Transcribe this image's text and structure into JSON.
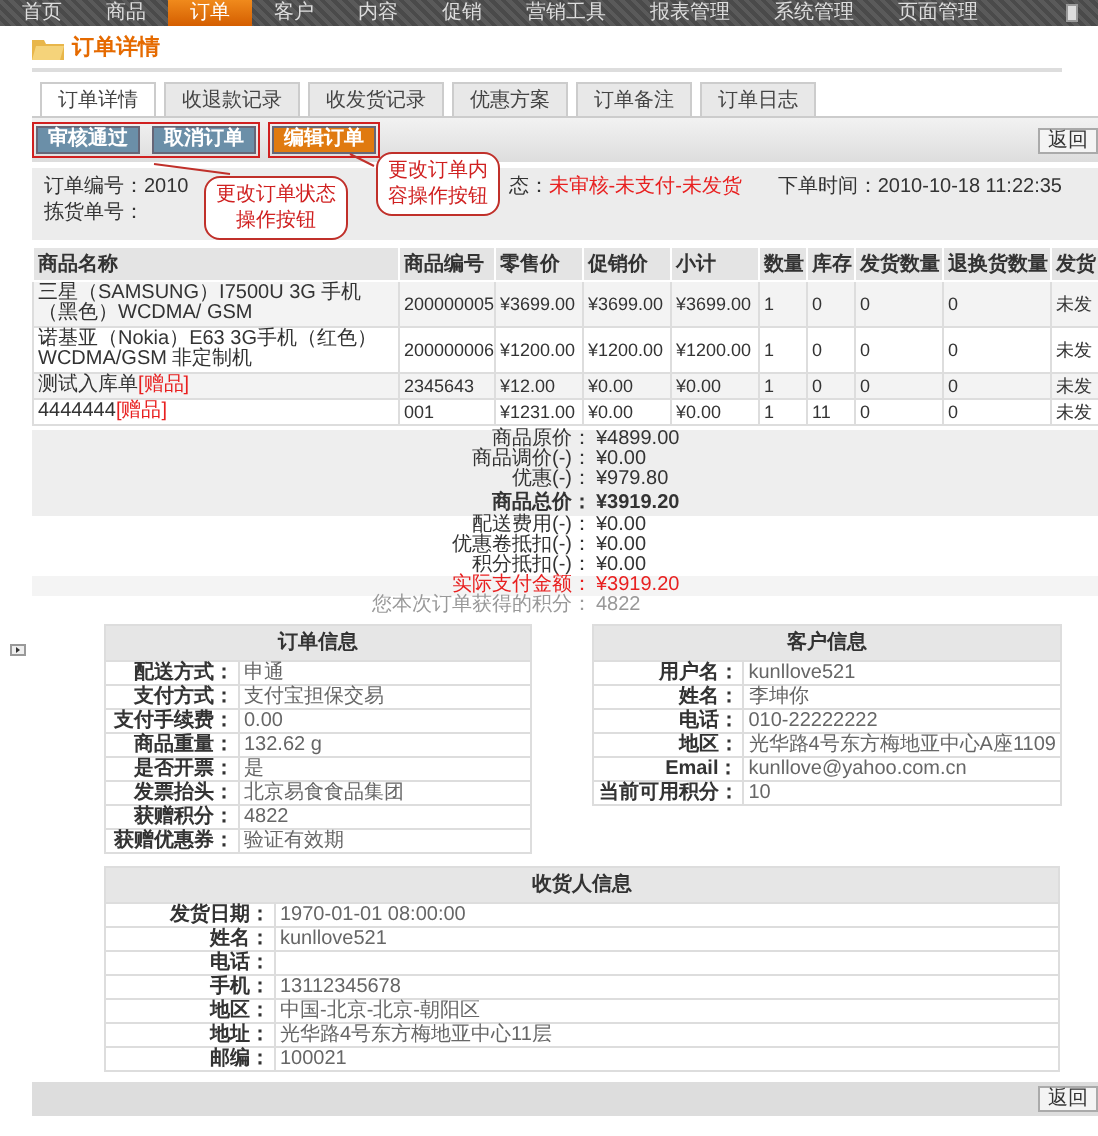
{
  "nav": [
    {
      "label": "首页",
      "selected": false
    },
    {
      "label": "商品",
      "selected": false
    },
    {
      "label": "订单",
      "selected": true
    },
    {
      "label": "客户",
      "selected": false
    },
    {
      "label": "内容",
      "selected": false
    },
    {
      "label": "促销",
      "selected": false
    },
    {
      "label": "营销工具",
      "selected": false
    },
    {
      "label": "报表管理",
      "selected": false
    },
    {
      "label": "系统管理",
      "selected": false
    },
    {
      "label": "页面管理",
      "selected": false
    }
  ],
  "page_title": "订单详情",
  "tabs": [
    {
      "label": "订单详情",
      "selected": true
    },
    {
      "label": "收退款记录",
      "selected": false
    },
    {
      "label": "收发货记录",
      "selected": false
    },
    {
      "label": "优惠方案",
      "selected": false
    },
    {
      "label": "订单备注",
      "selected": false
    },
    {
      "label": "订单日志",
      "selected": false
    }
  ],
  "actions": [
    {
      "label": "审核通过",
      "kind": "status"
    },
    {
      "label": "取消订单",
      "kind": "status"
    },
    {
      "label": "编辑订单",
      "kind": "edit"
    }
  ],
  "top_back_label": "返回",
  "callouts": [
    {
      "lines": [
        "更改订单状态",
        "操作按钮"
      ]
    },
    {
      "lines": [
        "更改订单内",
        "容操作按钮"
      ]
    }
  ],
  "order_header": {
    "number_label": "订单编号：",
    "number_value": "2010",
    "status_label": "态：",
    "status_value": "未审核-未支付-未发货",
    "time_label": "下单时间：",
    "time_value": "2010-10-18 11:22:35",
    "pick_label": "拣货单号："
  },
  "products": {
    "columns": [
      "商品名称",
      "商品编号",
      "零售价",
      "促销价",
      "小计",
      "数量",
      "库存",
      "发货数量",
      "退换货数量",
      "发货"
    ],
    "rows": [
      {
        "tag": null,
        "cells": [
          "三星（SAMSUNG）I7500U 3G 手机（黑色）WCDMA/ GSM",
          "200000005",
          "¥3699.00",
          "¥3699.00",
          "¥3699.00",
          "1",
          "0",
          "0",
          "0",
          "未发"
        ]
      },
      {
        "tag": null,
        "cells": [
          "诺基亚（Nokia）E63 3G手机（红色） WCDMA/GSM 非定制机",
          "200000006",
          "¥1200.00",
          "¥1200.00",
          "¥1200.00",
          "1",
          "0",
          "0",
          "0",
          "未发"
        ]
      },
      {
        "tag": "[赠品]",
        "cells": [
          "测试入库单",
          "2345643",
          "¥12.00",
          "¥0.00",
          "¥0.00",
          "1",
          "0",
          "0",
          "0",
          "未发"
        ]
      },
      {
        "tag": "[赠品]",
        "cells": [
          "4444444",
          "001",
          "¥1231.00",
          "¥0.00",
          "¥0.00",
          "1",
          "11",
          "0",
          "0",
          "未发"
        ]
      }
    ]
  },
  "summary": [
    {
      "label": "商品原价：",
      "value": "¥4899.00",
      "kind": "normal"
    },
    {
      "label": "商品调价(-)：",
      "value": "¥0.00",
      "kind": "normal"
    },
    {
      "label": "优惠(-)：",
      "value": "¥979.80",
      "kind": "normal"
    },
    {
      "label": "商品总价：",
      "value": "¥3919.20",
      "kind": "total"
    },
    {
      "label": "配送费用(-)：",
      "value": "¥0.00",
      "kind": "plain"
    },
    {
      "label": "优惠卷抵扣(-)：",
      "value": "¥0.00",
      "kind": "plain"
    },
    {
      "label": "积分抵扣(-)：",
      "value": "¥0.00",
      "kind": "plain"
    },
    {
      "label": "实际支付金额：",
      "value": "¥3919.20",
      "kind": "paid"
    },
    {
      "label": "您本次订单获得的积分：",
      "value": "4822",
      "kind": "points"
    }
  ],
  "order_info": {
    "title": "订单信息",
    "rows": [
      {
        "label": "配送方式：",
        "value": "申通"
      },
      {
        "label": "支付方式：",
        "value": "支付宝担保交易"
      },
      {
        "label": "支付手续费：",
        "value": "0.00"
      },
      {
        "label": "商品重量：",
        "value": "132.62 g"
      },
      {
        "label": "是否开票：",
        "value": "是"
      },
      {
        "label": "发票抬头：",
        "value": "北京易食食品集团"
      },
      {
        "label": "获赠积分：",
        "value": "4822"
      },
      {
        "label": "获赠优惠券：",
        "value": "验证有效期"
      }
    ]
  },
  "customer_info": {
    "title": "客户信息",
    "rows": [
      {
        "label": "用户名：",
        "value": "kunllove521"
      },
      {
        "label": "姓名：",
        "value": "李坤你"
      },
      {
        "label": "电话：",
        "value": "010-22222222"
      },
      {
        "label": "地区：",
        "value": "光华路4号东方梅地亚中心A座1109"
      },
      {
        "label": "Email：",
        "value": "kunllove@yahoo.com.cn"
      },
      {
        "label": "当前可用积分：",
        "value": "10"
      }
    ]
  },
  "receiver_info": {
    "title": "收货人信息",
    "rows": [
      {
        "label": "发货日期：",
        "value": "1970-01-01 08:00:00"
      },
      {
        "label": "姓名：",
        "value": "kunllove521"
      },
      {
        "label": "电话：",
        "value": null
      },
      {
        "label": "手机：",
        "value": "13112345678"
      },
      {
        "label": "地区：",
        "value": "中国-北京-北京-朝阳区"
      },
      {
        "label": "地址：",
        "value": "光华路4号东方梅地亚中心11层"
      },
      {
        "label": "邮编：",
        "value": "100021"
      }
    ]
  },
  "bottom_back_label": "返回"
}
